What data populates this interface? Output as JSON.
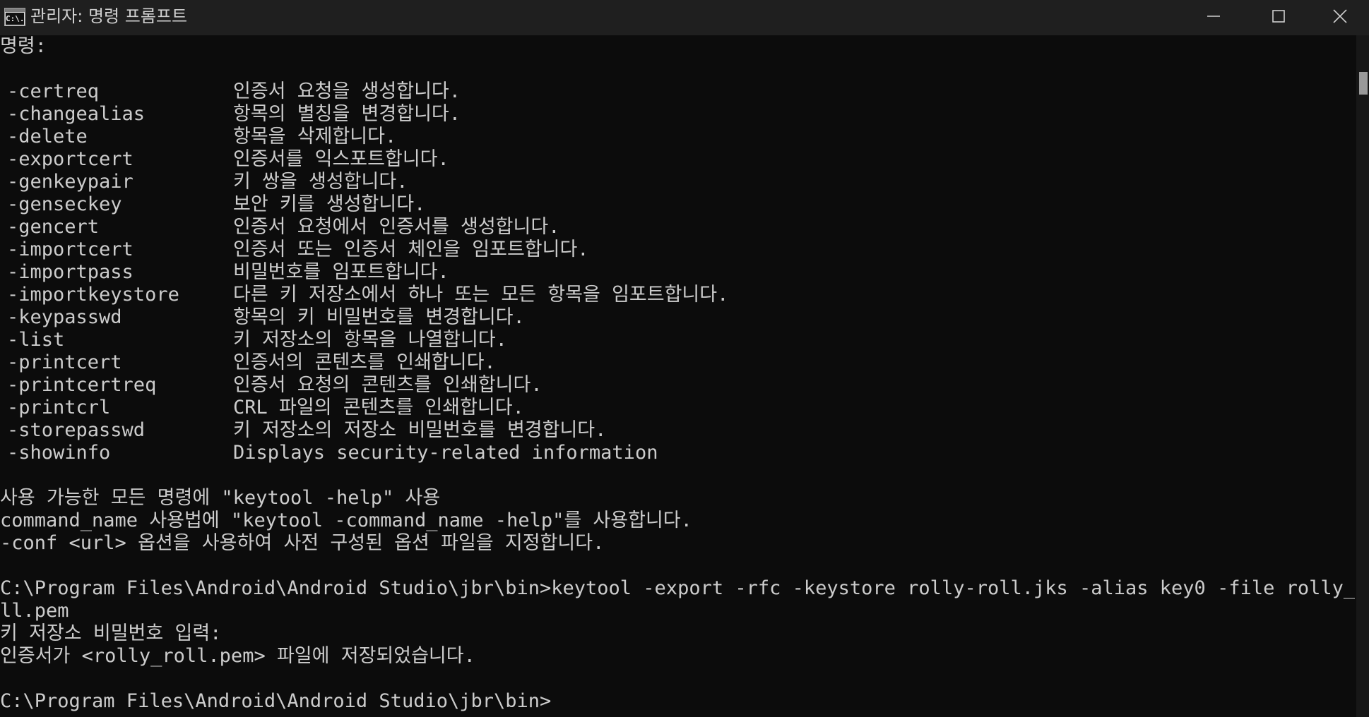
{
  "window": {
    "title": "관리자: 명령 프롬프트",
    "icon_text": "C:\\."
  },
  "console": {
    "heading": "명령:",
    "commands": [
      {
        "name": "-certreq",
        "desc": "인증서 요청을 생성합니다."
      },
      {
        "name": "-changealias",
        "desc": "항목의 별칭을 변경합니다."
      },
      {
        "name": "-delete",
        "desc": "항목을 삭제합니다."
      },
      {
        "name": "-exportcert",
        "desc": "인증서를 익스포트합니다."
      },
      {
        "name": "-genkeypair",
        "desc": "키 쌍을 생성합니다."
      },
      {
        "name": "-genseckey",
        "desc": "보안 키를 생성합니다."
      },
      {
        "name": "-gencert",
        "desc": "인증서 요청에서 인증서를 생성합니다."
      },
      {
        "name": "-importcert",
        "desc": "인증서 또는 인증서 체인을 임포트합니다."
      },
      {
        "name": "-importpass",
        "desc": "비밀번호를 임포트합니다."
      },
      {
        "name": "-importkeystore",
        "desc": "다른 키 저장소에서 하나 또는 모든 항목을 임포트합니다."
      },
      {
        "name": "-keypasswd",
        "desc": "항목의 키 비밀번호를 변경합니다."
      },
      {
        "name": "-list",
        "desc": "키 저장소의 항목을 나열합니다."
      },
      {
        "name": "-printcert",
        "desc": "인증서의 콘텐츠를 인쇄합니다."
      },
      {
        "name": "-printcertreq",
        "desc": "인증서 요청의 콘텐츠를 인쇄합니다."
      },
      {
        "name": "-printcrl",
        "desc": "CRL 파일의 콘텐츠를 인쇄합니다."
      },
      {
        "name": "-storepasswd",
        "desc": "키 저장소의 저장소 비밀번호를 변경합니다."
      },
      {
        "name": "-showinfo",
        "desc": "Displays security-related information"
      }
    ],
    "help_lines": [
      "사용 가능한 모든 명령에 \"keytool -help\" 사용",
      "command_name 사용법에 \"keytool -command_name -help\"를 사용합니다.",
      "-conf <url> 옵션을 사용하여 사전 구성된 옵션 파일을 지정합니다."
    ],
    "prompt_command_line1": "C:\\Program Files\\Android\\Android Studio\\jbr\\bin>keytool -export -rfc -keystore rolly-roll.jks -alias key0 -file rolly_ro",
    "prompt_command_line2": "ll.pem",
    "password_prompt": "키 저장소 비밀번호 입력:",
    "saved_message": "인증서가 <rolly_roll.pem> 파일에 저장되었습니다.",
    "final_prompt": "C:\\Program Files\\Android\\Android Studio\\jbr\\bin>"
  }
}
